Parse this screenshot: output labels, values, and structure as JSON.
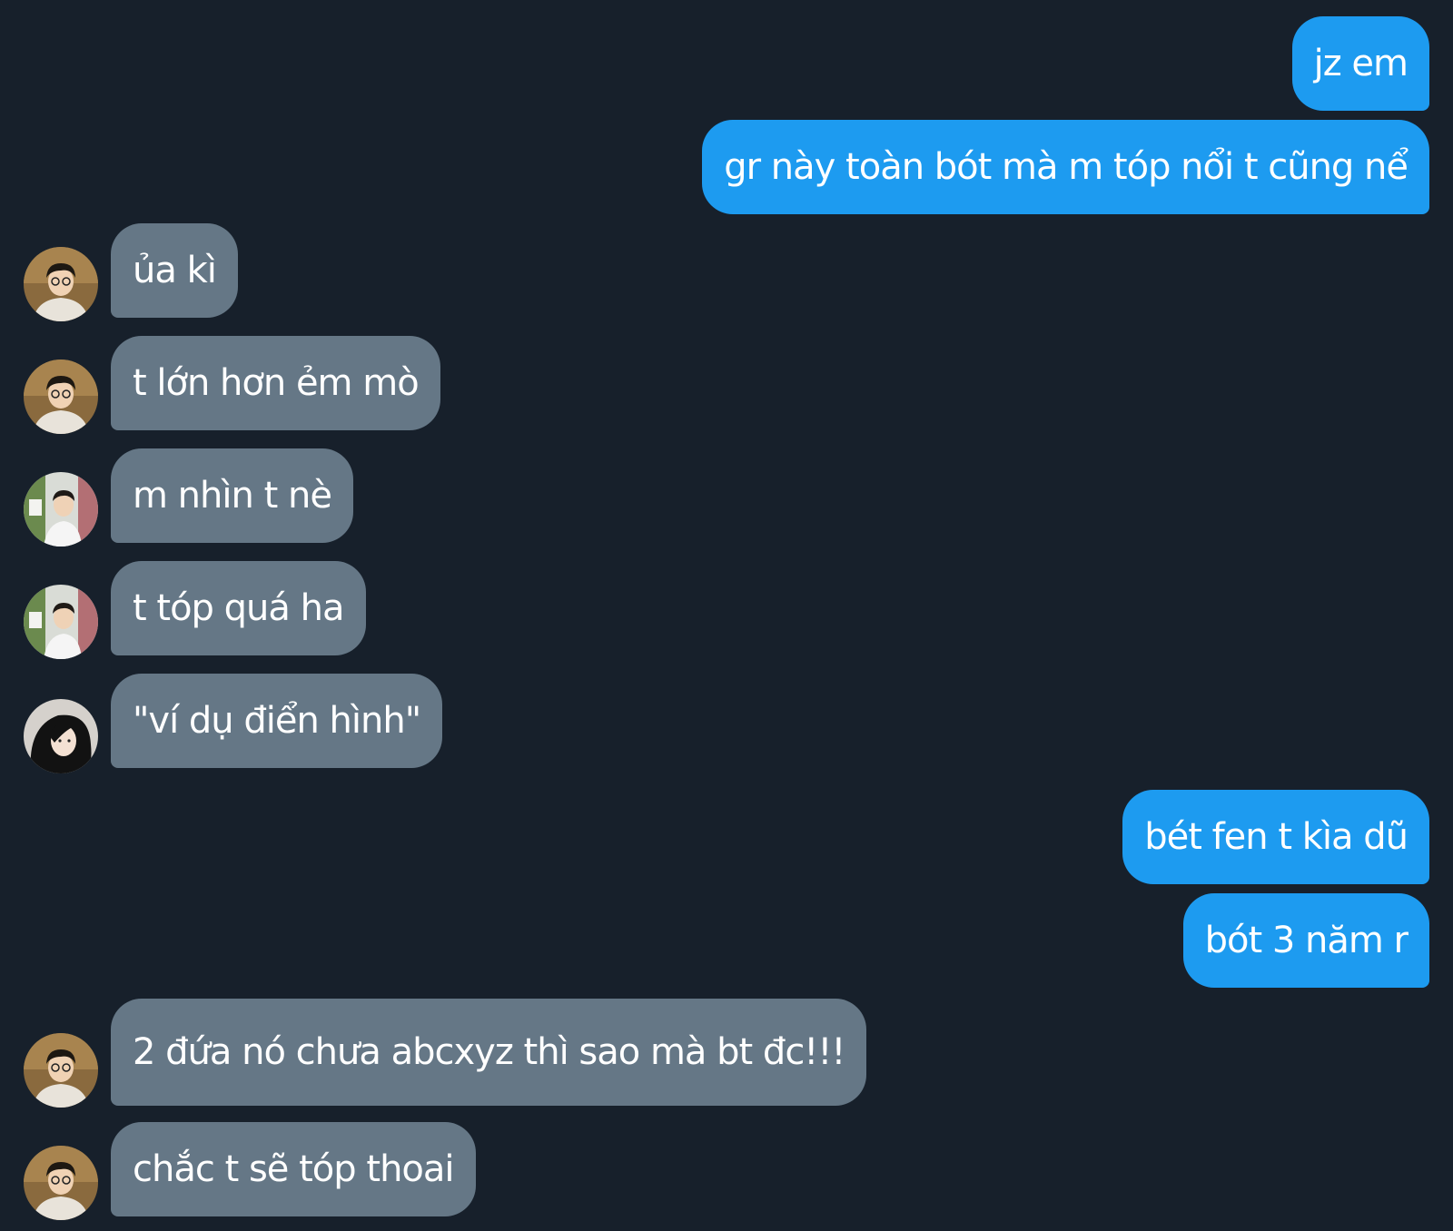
{
  "messages": [
    {
      "side": "out",
      "text": "jz em"
    },
    {
      "side": "out",
      "text": "gr này toàn bót mà m tóp nổi t cũng nể"
    },
    {
      "side": "in",
      "avatar": "boy-glasses",
      "text": "ủa kì"
    },
    {
      "side": "in",
      "avatar": "boy-glasses",
      "text": "t lớn hơn ẻm mò"
    },
    {
      "side": "in",
      "avatar": "boy-room",
      "text": "m nhìn t nè"
    },
    {
      "side": "in",
      "avatar": "boy-room",
      "text": "t tóp quá ha"
    },
    {
      "side": "in",
      "avatar": "girl-dark-hair",
      "text": "\"ví dụ điển hình\""
    },
    {
      "side": "out",
      "text": "bét fen t kìa dũ"
    },
    {
      "side": "out",
      "text": "bót 3 năm r"
    },
    {
      "side": "in",
      "avatar": "boy-glasses",
      "text": "2 đứa nó chưa abcxyz thì sao mà bt đc!!!"
    },
    {
      "side": "in",
      "avatar": "boy-glasses",
      "text": "chắc t sẽ tóp thoai"
    }
  ],
  "colors": {
    "background": "#17202b",
    "outgoing_bubble": "#1d9bf0",
    "incoming_bubble": "#657786",
    "text": "#ffffff"
  }
}
